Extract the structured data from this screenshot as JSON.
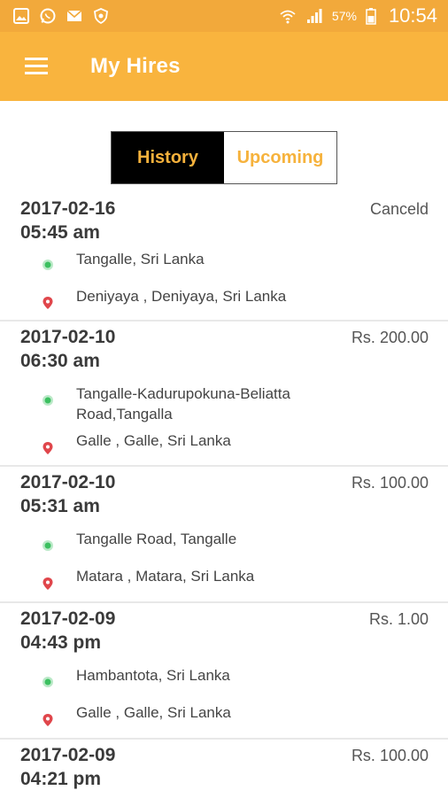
{
  "status_bar": {
    "battery_percent": "57%",
    "time": "10:54",
    "icons": [
      "gallery-icon",
      "whatsapp-icon",
      "mail-icon",
      "shield-icon",
      "wifi-icon",
      "signal-icon",
      "battery-icon"
    ]
  },
  "app_bar": {
    "title": "My Hires",
    "menu_icon": "hamburger-menu-icon"
  },
  "tabs": [
    {
      "label": "History",
      "active": true
    },
    {
      "label": "Upcoming",
      "active": false
    }
  ],
  "hires": [
    {
      "date": "2017-02-16",
      "time": "05:45 am",
      "amount": "Canceld",
      "pickup": "Tangalle, Sri Lanka",
      "dropoff": "Deniyaya , Deniyaya, Sri Lanka"
    },
    {
      "date": "2017-02-10",
      "time": "06:30 am",
      "amount": "Rs. 200.00",
      "pickup": "Tangalle-Kadurupokuna-Beliatta Road,Tangalla",
      "dropoff": "Galle , Galle, Sri Lanka"
    },
    {
      "date": "2017-02-10",
      "time": "05:31 am",
      "amount": "Rs. 100.00",
      "pickup": "Tangalle Road, Tangalle",
      "dropoff": "Matara , Matara, Sri Lanka"
    },
    {
      "date": "2017-02-09",
      "time": "04:43 pm",
      "amount": "Rs. 1.00",
      "pickup": "Hambantota, Sri Lanka",
      "dropoff": "Galle , Galle, Sri Lanka"
    },
    {
      "date": "2017-02-09",
      "time": "04:21 pm",
      "amount": "Rs. 100.00"
    }
  ],
  "colors": {
    "status_bar": "#F2A93B",
    "app_bar": "#F9B43E",
    "accent": "#F6B23C",
    "pickup_dot": "#3CC060",
    "dropoff_pin": "#E0464B"
  }
}
